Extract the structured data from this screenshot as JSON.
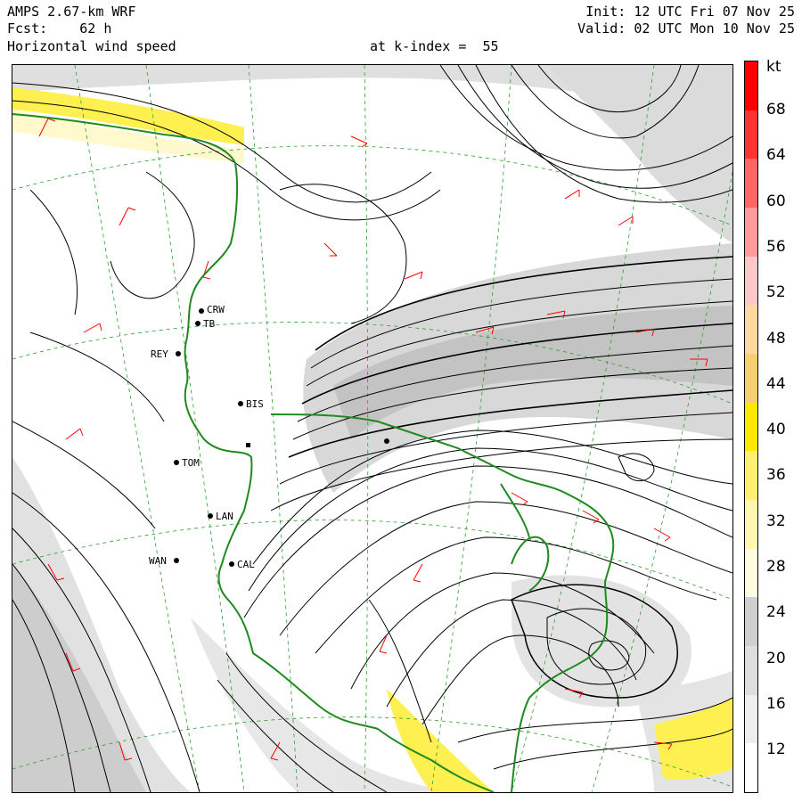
{
  "header": {
    "model": "AMPS 2.67-km WRF",
    "forecast_label": "Fcst:",
    "forecast_value": "62 h",
    "field_title": "Horizontal wind speed",
    "level_label": "at k-index =",
    "level_value": "55",
    "init": "Init: 12 UTC Fri 07 Nov 25",
    "valid": "Valid: 02 UTC Mon 10 Nov 25"
  },
  "colorbar": {
    "unit": "kt",
    "labels": [
      "68",
      "64",
      "60",
      "56",
      "52",
      "48",
      "44",
      "40",
      "36",
      "32",
      "28",
      "24",
      "20",
      "16",
      "12"
    ],
    "colors": [
      "#ffffff",
      "#eeeeee",
      "#dedede",
      "#cfcfcf",
      "#fffce0",
      "#fff7b0",
      "#fff070",
      "#ffe800",
      "#f5d070",
      "#ffd9a0",
      "#ffc8c8",
      "#ff9a9a",
      "#ff6666",
      "#ff3333",
      "#ff0000"
    ]
  },
  "stations": [
    {
      "name": "CRW",
      "color": "#000"
    },
    {
      "name": "TB",
      "color": "#000"
    },
    {
      "name": "REY",
      "color": "#000"
    },
    {
      "name": "BIS",
      "color": "#000"
    },
    {
      "name": "TOM",
      "color": "#000"
    },
    {
      "name": "LAN",
      "color": "#000"
    },
    {
      "name": "WAN",
      "color": "#000"
    },
    {
      "name": "CAL",
      "color": "#000"
    }
  ],
  "map_colors": {
    "coastline": "#1f8a1f",
    "grid": "#2e9e2e",
    "streamline": "#000000",
    "barb": "#ff0000",
    "shade_light": "#e6e6e6",
    "shade_mid": "#cccccc",
    "yellow": "#ffef40",
    "pale_yellow": "#fff9c8"
  }
}
